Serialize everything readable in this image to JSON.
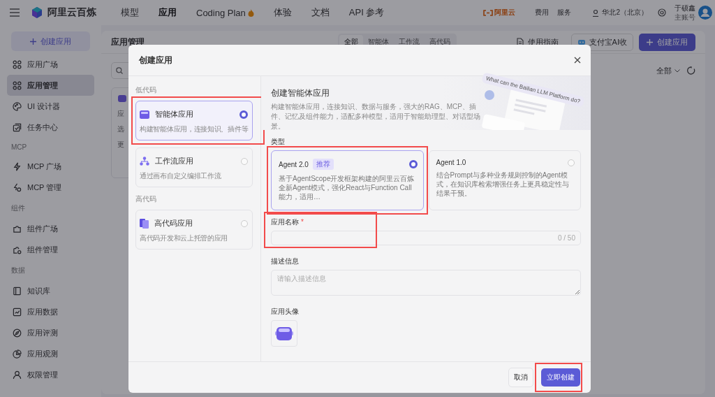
{
  "topbar": {
    "brand": "阿里云百炼",
    "nav": [
      {
        "label": "模型",
        "selected": false
      },
      {
        "label": "应用",
        "selected": true
      },
      {
        "label": "Coding Plan",
        "kind": "hot",
        "selected": false
      },
      {
        "label": "体验",
        "selected": false
      },
      {
        "label": "文档",
        "selected": false
      },
      {
        "label": "API 参考",
        "selected": false
      }
    ],
    "cloud_logo": "阿里云",
    "links": [
      "费用",
      "服务"
    ],
    "region": "华北2（北京）",
    "user": {
      "name": "于硕鑫",
      "role": "主账号"
    }
  },
  "sidebar": {
    "create_button": "创建应用",
    "sections": [
      {
        "items": [
          {
            "label": "应用广场",
            "selected": false
          },
          {
            "label": "应用管理",
            "selected": true
          },
          {
            "label": "UI 设计器",
            "selected": false
          },
          {
            "label": "任务中心",
            "selected": false
          }
        ]
      },
      {
        "title": "MCP",
        "items": [
          {
            "label": "MCP 广场",
            "selected": false
          },
          {
            "label": "MCP 管理",
            "selected": false
          }
        ]
      },
      {
        "title": "组件",
        "items": [
          {
            "label": "组件广场",
            "selected": false
          },
          {
            "label": "组件管理",
            "selected": false
          }
        ]
      },
      {
        "title": "数据",
        "items": [
          {
            "label": "知识库",
            "selected": false
          },
          {
            "label": "应用数据",
            "selected": false
          },
          {
            "label": "应用评测",
            "selected": false
          },
          {
            "label": "应用观测",
            "selected": false
          },
          {
            "label": "权限管理",
            "selected": false
          }
        ]
      }
    ]
  },
  "page": {
    "title": "应用管理",
    "filters": [
      {
        "label": "全部",
        "selected": true
      },
      {
        "label": "智能体",
        "selected": false
      },
      {
        "label": "工作流",
        "selected": false
      },
      {
        "label": "高代码",
        "selected": false
      }
    ],
    "guide_link": "使用指南",
    "alipay_button": "支付宝AI收",
    "create_button": "创建应用",
    "scope_select": "全部",
    "card_fragments": [
      "应",
      "选",
      "更"
    ]
  },
  "dialog": {
    "title": "创建应用",
    "categories": [
      {
        "title": "低代码",
        "options": [
          {
            "title": "智能体应用",
            "description": "构建智能体应用，连接知识、插件等",
            "selected": true,
            "highlighted": true
          },
          {
            "title": "工作流应用",
            "description": "通过画布自定义编排工作流",
            "selected": false,
            "highlighted": false
          }
        ]
      },
      {
        "title": "高代码",
        "options": [
          {
            "title": "高代码应用",
            "description": "高代码开发和云上托管的应用",
            "selected": false,
            "highlighted": false
          }
        ]
      }
    ],
    "banner": {
      "title": "创建智能体应用",
      "description": "构建智能体应用，连接知识、数据与服务，强大的RAG、MCP、插件、记忆及组件能力，适配多种模型，适用于智能助理型、对话型场景。",
      "bubble": "What can the Bailian LLM Platform do?"
    },
    "type_label": "类型",
    "types": [
      {
        "name": "Agent 2.0",
        "badge": "推荐",
        "description": "基于AgentScope开发框架构建的阿里云百炼全新Agent模式，强化React与Function Call能力，适用…",
        "selected": true,
        "highlighted": true
      },
      {
        "name": "Agent 1.0",
        "description": "结合Prompt与多种业务规则控制的Agent模式，在知识库检索增强任务上更具稳定性与结果干预。",
        "selected": false,
        "highlighted": false
      }
    ],
    "name_field": {
      "label": "应用名称",
      "required_mark": "*",
      "counter": "0 / 50",
      "highlighted": true
    },
    "description_field": {
      "label": "描述信息",
      "placeholder": "请输入描述信息"
    },
    "avatar_label": "应用头像",
    "cancel_button": "取消",
    "create_button": {
      "label": "立即创建",
      "highlighted": true
    }
  }
}
